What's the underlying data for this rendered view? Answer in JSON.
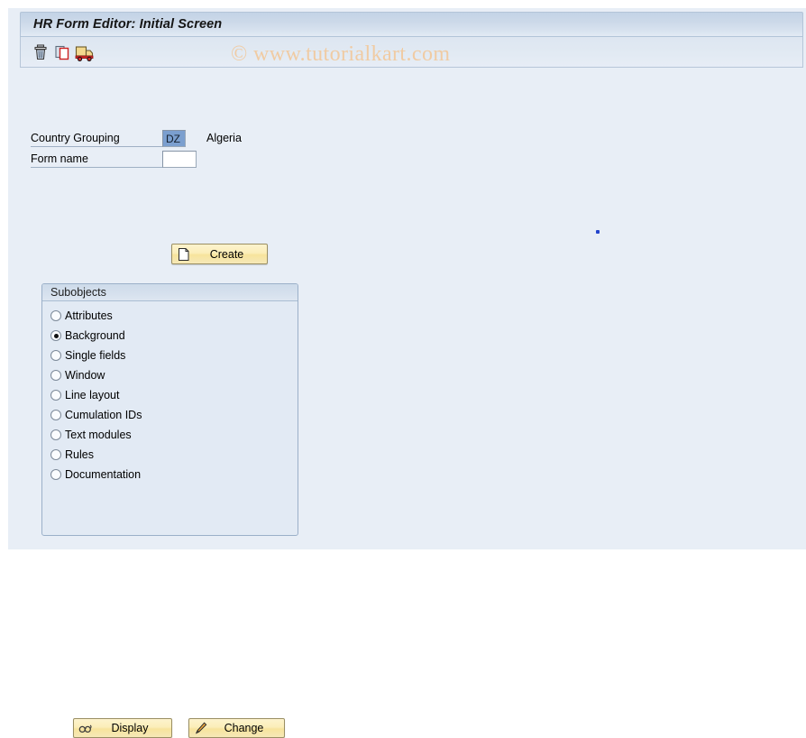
{
  "window": {
    "title": "HR Form Editor: Initial Screen"
  },
  "watermark": {
    "text": "© www.tutorialkart.com"
  },
  "toolbar": {
    "buttons": [
      {
        "name": "delete-icon",
        "tooltip": "Delete"
      },
      {
        "name": "copy-icon",
        "tooltip": "Copy"
      },
      {
        "name": "transport-icon",
        "tooltip": "Transport"
      }
    ]
  },
  "form": {
    "country_grouping": {
      "label": "Country Grouping",
      "value": "DZ",
      "description": "Algeria"
    },
    "form_name": {
      "label": "Form name",
      "value": "",
      "placeholder": ""
    },
    "create_button": {
      "label": "Create",
      "icon": "new-document-icon"
    }
  },
  "subobjects": {
    "title": "Subobjects",
    "selected": "Background",
    "options": [
      {
        "label": "Attributes",
        "checked": false
      },
      {
        "label": "Background",
        "checked": true
      },
      {
        "label": "Single fields",
        "checked": false
      },
      {
        "label": "Window",
        "checked": false
      },
      {
        "label": "Line layout",
        "checked": false
      },
      {
        "label": "Cumulation IDs",
        "checked": false
      },
      {
        "label": "Text modules",
        "checked": false
      },
      {
        "label": "Rules",
        "checked": false
      },
      {
        "label": "Documentation",
        "checked": false
      }
    ],
    "actions": {
      "display": {
        "label": "Display",
        "icon": "glasses-icon"
      },
      "change": {
        "label": "Change",
        "icon": "pencil-icon"
      }
    }
  },
  "colors": {
    "window_background": "#e8eef6",
    "titlebar": "#ccd9e9",
    "button_yellow": "#f8ecb9",
    "selected_field": "#7b9fcf",
    "watermark": "#f0cba3"
  }
}
